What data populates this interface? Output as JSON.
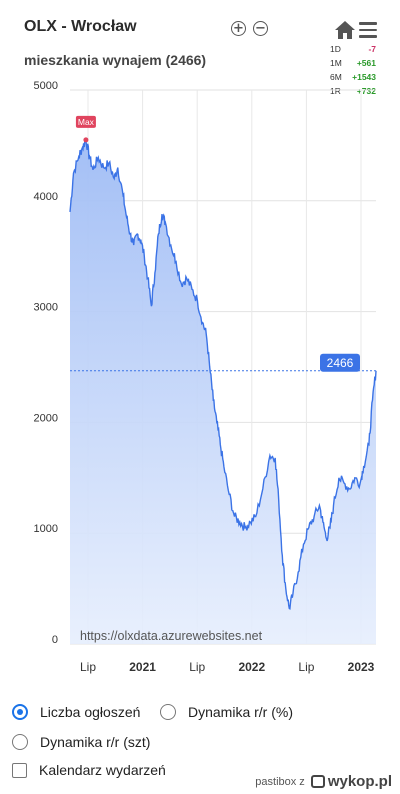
{
  "header": {
    "title": "OLX - Wrocław",
    "subtitle": "mieszkania wynajem (2466)",
    "zoom_in": "+",
    "zoom_out": "−",
    "home_icon": "home-icon",
    "menu_icon": "hamburger-menu-icon"
  },
  "stats": [
    {
      "period": "1D",
      "value": "-7",
      "trend": "neg"
    },
    {
      "period": "1M",
      "value": "+561",
      "trend": "pos"
    },
    {
      "period": "6M",
      "value": "+1543",
      "trend": "pos"
    },
    {
      "period": "1R",
      "value": "+732",
      "trend": "pos"
    }
  ],
  "colors": {
    "area_fill": "#a9c4f7",
    "line": "#3b73e6",
    "label_blue": "#3b73e6",
    "max_label": "#e0445e"
  },
  "chart_data": {
    "type": "area",
    "ylim": [
      0,
      5000
    ],
    "yticks": [
      "0",
      "1000",
      "2000",
      "3000",
      "4000",
      "5000"
    ],
    "xticks": [
      {
        "label": "Lip",
        "bold": false,
        "t": 0.5
      },
      {
        "label": "2021",
        "bold": true,
        "t": 1.0
      },
      {
        "label": "Lip",
        "bold": false,
        "t": 1.5
      },
      {
        "label": "2022",
        "bold": true,
        "t": 2.0
      },
      {
        "label": "Lip",
        "bold": false,
        "t": 2.5
      },
      {
        "label": "2023",
        "bold": true,
        "t": 3.0
      }
    ],
    "grid": true,
    "series": [
      {
        "values": [
          [
            0.31,
            3900
          ],
          [
            0.33,
            4250
          ],
          [
            0.36,
            4400
          ],
          [
            0.38,
            4480
          ],
          [
            0.4,
            4550
          ],
          [
            0.42,
            4400
          ],
          [
            0.44,
            4280
          ],
          [
            0.47,
            4390
          ],
          [
            0.5,
            4300
          ],
          [
            0.53,
            4340
          ],
          [
            0.56,
            4200
          ],
          [
            0.58,
            4300
          ],
          [
            0.61,
            4050
          ],
          [
            0.63,
            3850
          ],
          [
            0.65,
            3700
          ],
          [
            0.67,
            3600
          ],
          [
            0.69,
            3700
          ],
          [
            0.71,
            3650
          ],
          [
            0.73,
            3500
          ],
          [
            0.75,
            3300
          ],
          [
            0.77,
            3050
          ],
          [
            0.79,
            3350
          ],
          [
            0.81,
            3700
          ],
          [
            0.83,
            3880
          ],
          [
            0.85,
            3800
          ],
          [
            0.88,
            3600
          ],
          [
            0.91,
            3450
          ],
          [
            0.94,
            3250
          ],
          [
            0.97,
            3300
          ],
          [
            1.0,
            3200
          ],
          [
            1.03,
            3100
          ],
          [
            1.06,
            2900
          ],
          [
            1.08,
            2800
          ],
          [
            1.1,
            2500
          ],
          [
            1.12,
            2200
          ],
          [
            1.14,
            2000
          ],
          [
            1.16,
            1800
          ],
          [
            1.18,
            1600
          ],
          [
            1.21,
            1350
          ],
          [
            1.24,
            1150
          ],
          [
            1.27,
            1100
          ],
          [
            1.3,
            1050
          ],
          [
            1.33,
            1100
          ],
          [
            1.36,
            1150
          ],
          [
            1.4,
            1400
          ],
          [
            1.44,
            1700
          ],
          [
            1.47,
            1680
          ],
          [
            1.49,
            1300
          ],
          [
            1.51,
            800
          ],
          [
            1.53,
            500
          ],
          [
            1.55,
            320
          ],
          [
            1.57,
            450
          ],
          [
            1.6,
            650
          ],
          [
            1.63,
            900
          ],
          [
            1.66,
            1050
          ],
          [
            1.69,
            1150
          ],
          [
            1.72,
            1250
          ],
          [
            1.74,
            1100
          ],
          [
            1.76,
            950
          ],
          [
            1.78,
            1050
          ],
          [
            1.8,
            1250
          ],
          [
            1.83,
            1500
          ],
          [
            1.86,
            1450
          ],
          [
            1.89,
            1400
          ],
          [
            1.92,
            1500
          ],
          [
            1.95,
            1450
          ],
          [
            1.97,
            1600
          ],
          [
            2.0,
            1800
          ],
          [
            2.02,
            2200
          ],
          [
            2.04,
            2466
          ]
        ]
      }
    ],
    "max_label": "Max",
    "max_point": [
      0.4,
      4550
    ],
    "current_label": "2466",
    "current_value": 2466,
    "watermark": "https://olxdata.azurewebsites.net"
  },
  "options": {
    "count_label": "Liczba ogłoszeń",
    "dyn_pct_label": "Dynamika r/r (%)",
    "dyn_abs_label": "Dynamika r/r (szt)",
    "calendar_label": "Kalendarz wydarzeń"
  },
  "footer": {
    "user": "pastibox z",
    "brand": "wykop.pl"
  }
}
